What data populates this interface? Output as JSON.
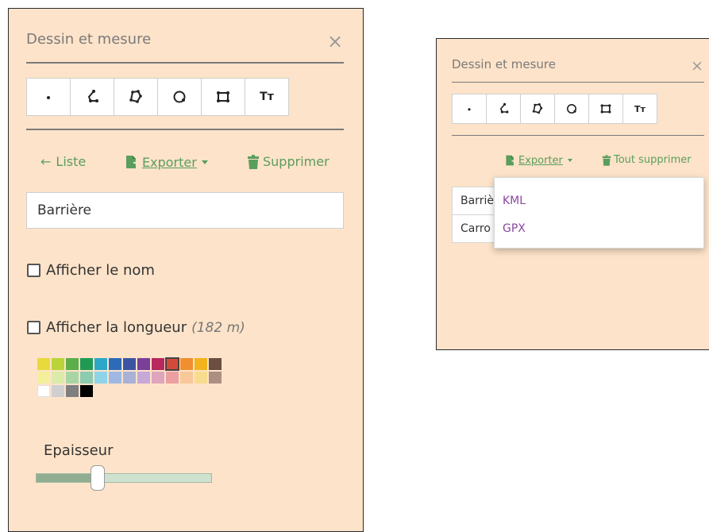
{
  "left_panel": {
    "title": "Dessin et mesure",
    "close": "×",
    "tools": [
      {
        "icon": "point-icon",
        "name": "tool-point"
      },
      {
        "icon": "line-icon",
        "name": "tool-line"
      },
      {
        "icon": "polygon-icon",
        "name": "tool-polygon"
      },
      {
        "icon": "circle-icon",
        "name": "tool-circle"
      },
      {
        "icon": "rectangle-icon",
        "name": "tool-rectangle"
      },
      {
        "icon": "text-icon",
        "name": "tool-text"
      }
    ],
    "text_tool_glyph": "Tт",
    "actions": {
      "list_arrow": "←",
      "list_label": "Liste",
      "export_label": "Exporter",
      "delete_label": "Supprimer"
    },
    "name_value": "Barrière",
    "show_name_label": "Afficher le nom",
    "show_length_label": "Afficher la longueur",
    "length_value": "(182 m)",
    "palette": [
      [
        "#e8d93c",
        "#b8d43a",
        "#5cae4a",
        "#1f9a55",
        "#2ba7c8",
        "#2d6ab8",
        "#3b55a3",
        "#7a3f98",
        "#b8275e",
        "#d24a3b",
        "#ef8f2f",
        "#f2b31d",
        "#6b4e3f"
      ],
      [
        "#f4ef9d",
        "#dcebaa",
        "#a9d5a4",
        "#8ccbb0",
        "#8fd3e8",
        "#9fb8e3",
        "#a9b2d6",
        "#c8a8d6",
        "#dea5bc",
        "#eb9fa0",
        "#f8c79a",
        "#f8dc8d",
        "#ad8f82"
      ],
      [
        "#ffffff",
        "#cfcfcf",
        "#7f7f7f",
        "#000000"
      ]
    ],
    "selected_color": "#d24a3b",
    "thickness_label": "Epaisseur",
    "thickness_value": 0.35
  },
  "right_panel": {
    "title": "Dessin et mesure",
    "close": "×",
    "text_tool_glyph": "Tт",
    "export_label": "Exporter",
    "delete_all_label": "Tout supprimer",
    "list_items": [
      "Barriè",
      "Carro"
    ],
    "dropdown_options": [
      "KML",
      "GPX"
    ]
  },
  "colors": {
    "panel_bg": "#fde3c9",
    "accent_green": "#5a9e5e",
    "dropdown_link": "#8a48a0"
  }
}
